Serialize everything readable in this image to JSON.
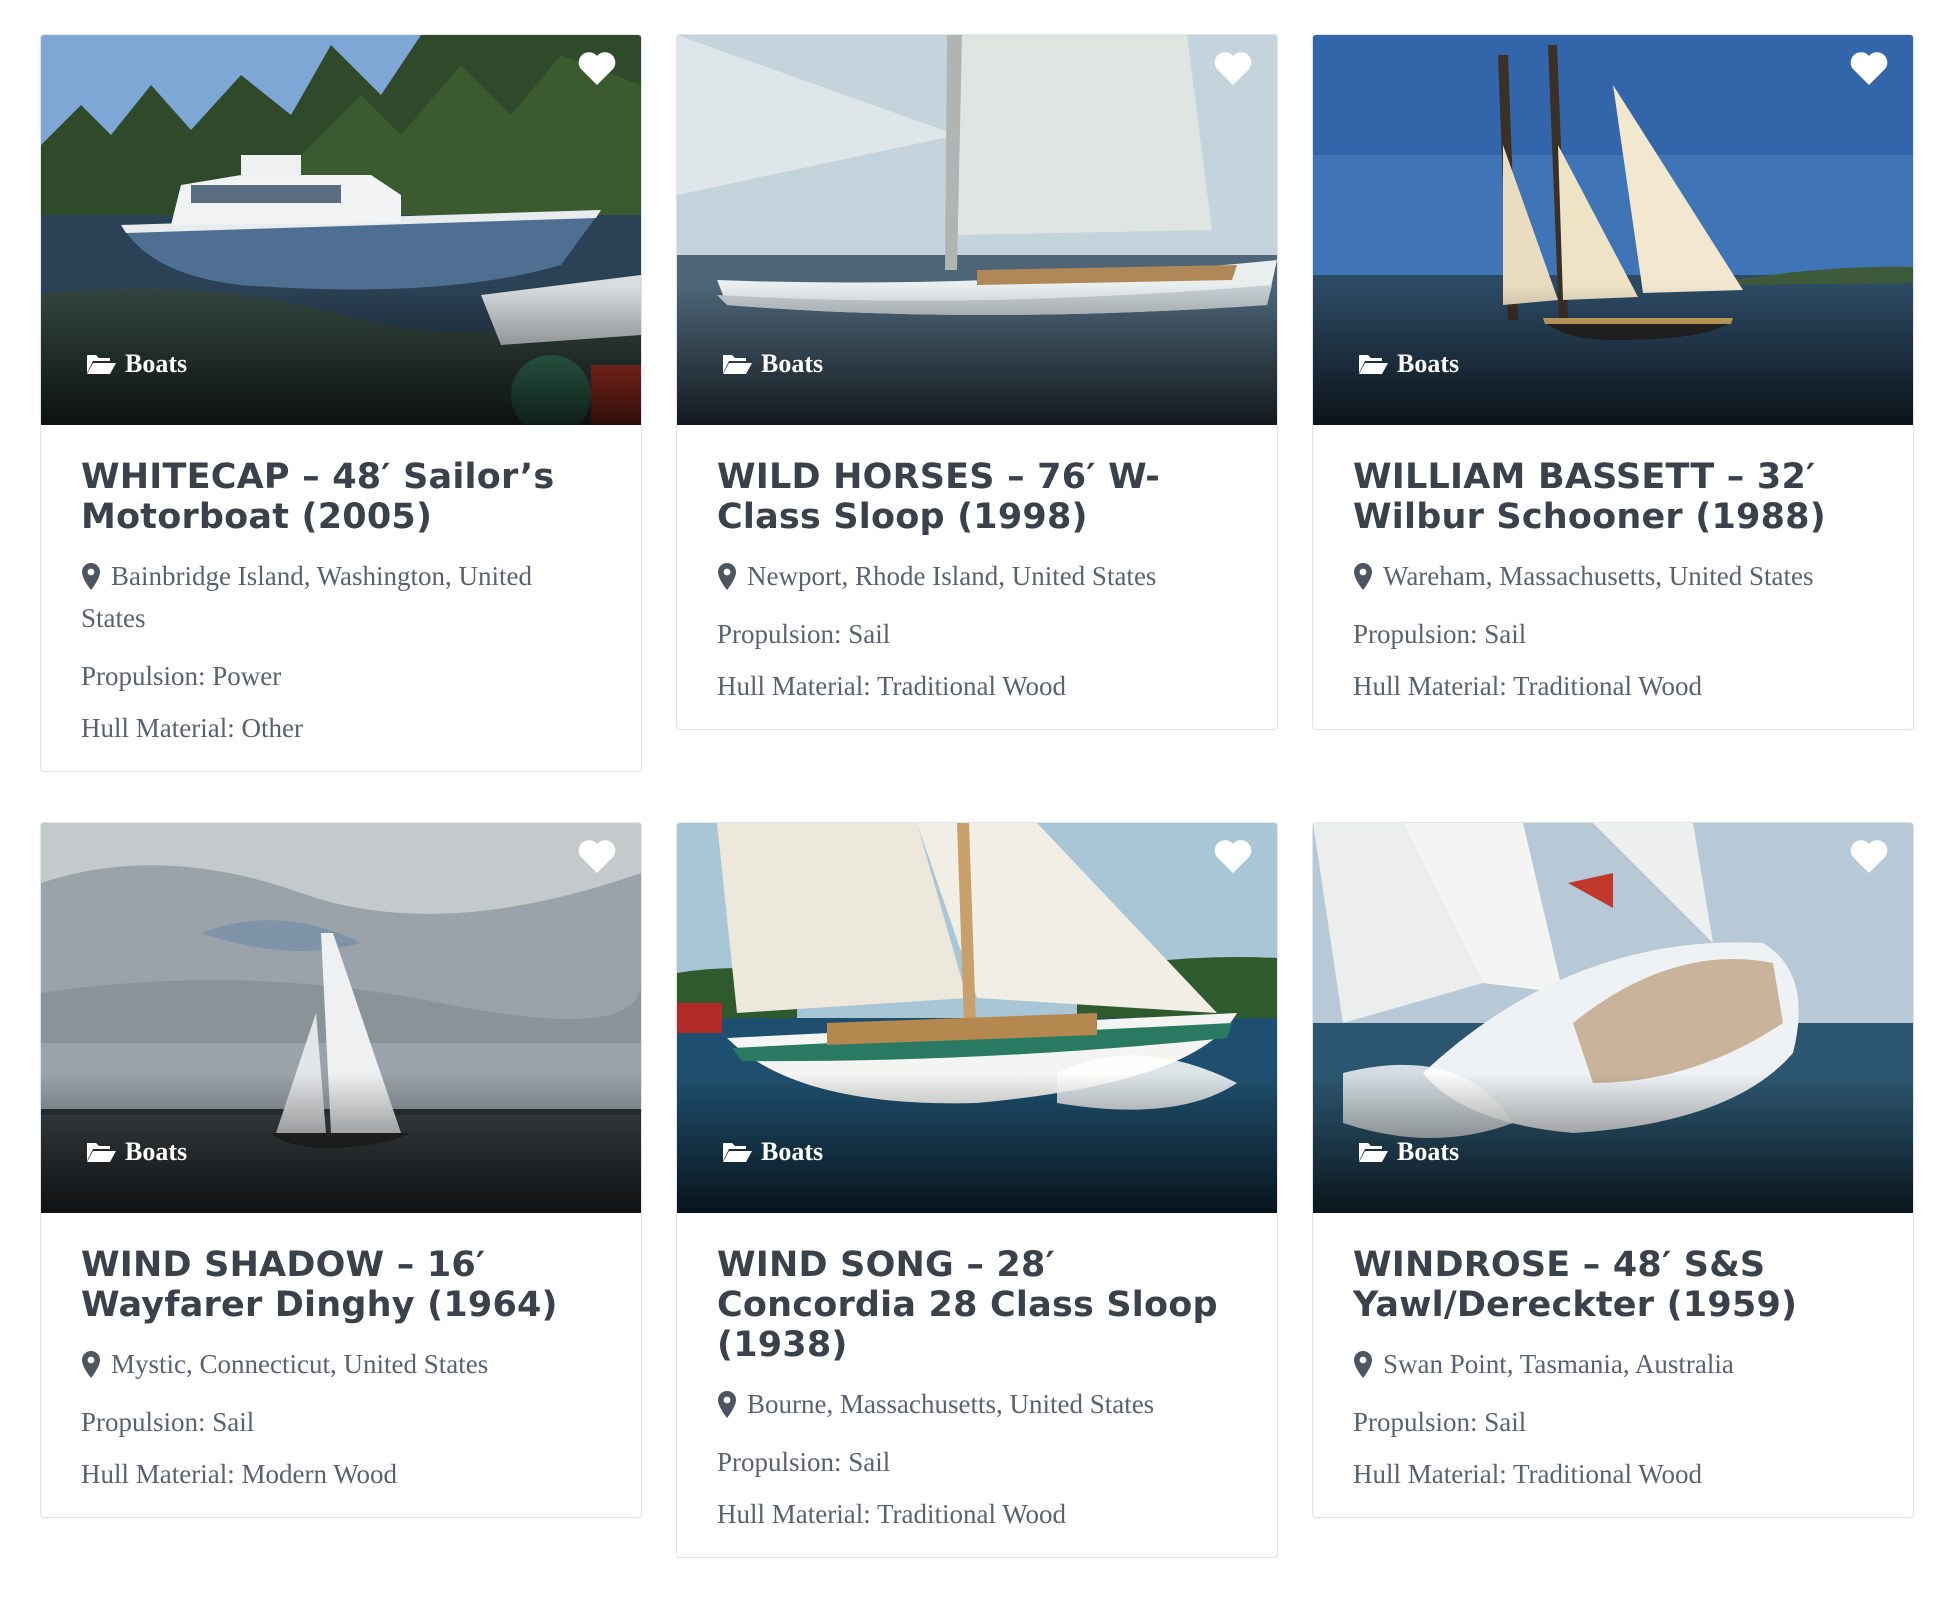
{
  "listings": [
    {
      "category": "Boats",
      "title": "WHITECAP – 48′ Sailor’s Motorboat (2005)",
      "location": "Bainbridge Island, Washington, United States",
      "propulsion": "Propulsion: Power",
      "hull": "Hull Material: Other"
    },
    {
      "category": "Boats",
      "title": "WILD HORSES – 76′ W-Class Sloop (1998)",
      "location": "Newport, Rhode Island, United States",
      "propulsion": "Propulsion: Sail",
      "hull": "Hull Material: Traditional Wood"
    },
    {
      "category": "Boats",
      "title": "WILLIAM BASSETT – 32′ Wilbur Schooner (1988)",
      "location": "Wareham, Massachusetts, United States",
      "propulsion": "Propulsion: Sail",
      "hull": "Hull Material: Traditional Wood"
    },
    {
      "category": "Boats",
      "title": "WIND SHADOW – 16′ Wayfarer Dinghy (1964)",
      "location": "Mystic, Connecticut, United States",
      "propulsion": "Propulsion: Sail",
      "hull": "Hull Material: Modern Wood"
    },
    {
      "category": "Boats",
      "title": "WIND SONG – 28′ Concordia 28 Class Sloop (1938)",
      "location": "Bourne, Massachusetts, United States",
      "propulsion": "Propulsion: Sail",
      "hull": "Hull Material: Traditional Wood"
    },
    {
      "category": "Boats",
      "title": "WINDROSE – 48′ S&S Yawl/Dereckter (1959)",
      "location": "Swan Point, Tasmania, Australia",
      "propulsion": "Propulsion: Sail",
      "hull": "Hull Material: Traditional Wood"
    }
  ],
  "icons": {
    "favorite": "heart-icon",
    "category": "folder-open-icon",
    "location": "map-marker-icon"
  },
  "colors": {
    "title": "#3a414b",
    "text": "#5a6270",
    "card_border": "#e1e4e8"
  }
}
